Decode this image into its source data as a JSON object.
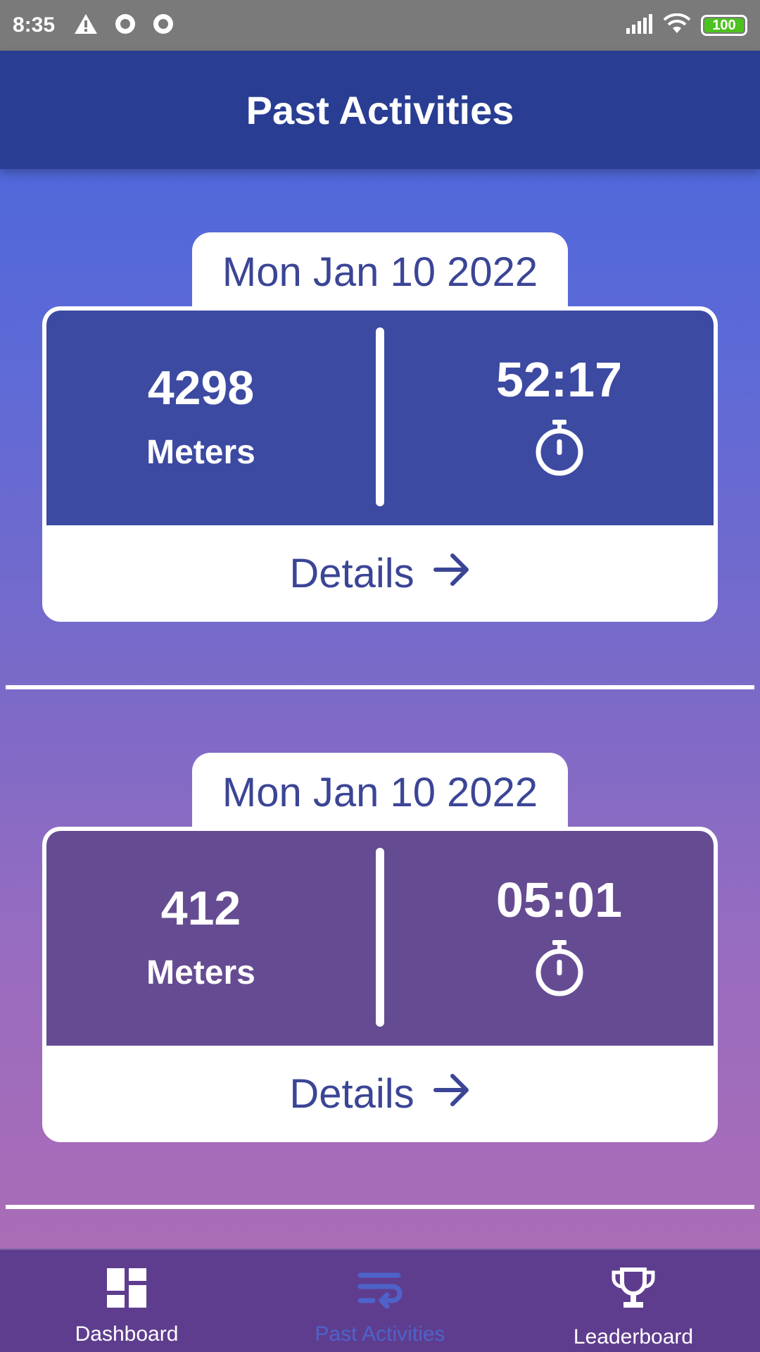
{
  "status_bar": {
    "time": "8:35",
    "battery": "100",
    "icons": [
      "warning-icon",
      "record-icon",
      "record-icon",
      "signal-icon",
      "wifi-icon",
      "battery-icon"
    ]
  },
  "app_bar": {
    "title": "Past Activities"
  },
  "activities": [
    {
      "date": "Mon Jan 10 2022",
      "distance": "4298",
      "unit": "Meters",
      "duration": "52:17",
      "details_label": "Details",
      "stats_color": "#3c4aa2"
    },
    {
      "date": "Mon Jan 10 2022",
      "distance": "412",
      "unit": "Meters",
      "duration": "05:01",
      "details_label": "Details",
      "stats_color": "#654c92"
    }
  ],
  "bottom_nav": {
    "items": [
      {
        "label": "Dashboard",
        "icon": "dashboard-icon",
        "active": false
      },
      {
        "label": "Past Activities",
        "icon": "past-activities-icon",
        "active": true
      },
      {
        "label": "Leaderboard",
        "icon": "trophy-icon",
        "active": false
      }
    ]
  },
  "colors": {
    "app_bar": "#293d93",
    "accent_text": "#3b4596",
    "nav_bg": "#5f3d8e",
    "nav_active": "#4d63c9"
  }
}
